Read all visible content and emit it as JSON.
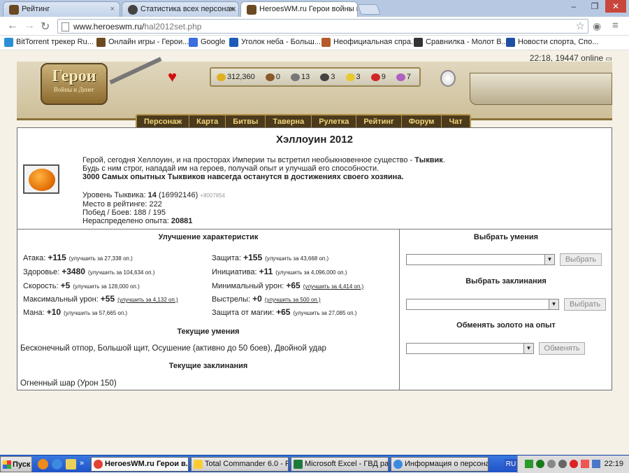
{
  "browser": {
    "tabs": [
      {
        "title": "Рейтинг",
        "active": false
      },
      {
        "title": "Статистика всех персонаж",
        "active": false
      },
      {
        "title": "HeroesWM.ru Герои войны и",
        "active": true
      }
    ],
    "close_glyph": "×",
    "url_host": "www.heroeswm.ru/",
    "url_path": "hal2012set.php",
    "bookmarks": [
      "BitTorrent трекер Ru...",
      "Онлайн игры - Герои...",
      "Google",
      "Уголок неба - Больш...",
      "Неофициальная спра...",
      "Сравнилка - Молот В...",
      "Новости спорта, Спо..."
    ]
  },
  "game": {
    "online_text": "22:18, 19447 online",
    "logo_main": "Герои",
    "logo_sub": "Войны и Денег",
    "resources": [
      "312,360",
      "0",
      "13",
      "3",
      "3",
      "9",
      "7"
    ],
    "menu": [
      "Персонаж",
      "Карта",
      "Битвы",
      "Таверна",
      "Рулетка",
      "Рейтинг",
      "Форум",
      "Чат"
    ]
  },
  "page": {
    "title": "Хэллоуин 2012",
    "intro_line1_a": "Герой, сегодня Хеллоуин, и на просторах Империи ты встретил необыкновенное существо - ",
    "intro_line1_b": "Тыквик",
    "intro_line1_c": ".",
    "intro_line2": "Будь с ним строг, нападай им на героев, получай опыт и улучшай его способности.",
    "intro_line3": "3000 Самых опытных Тыквиков навсегда останутся в достижениях своего хозяина.",
    "level_label": "Уровень Тыквика: ",
    "level_value": "14",
    "level_exp": " (16992146)",
    "level_delta": "+8007854",
    "rank": "Место в рейтинге: 222",
    "wins": "Побед / Боев: 188 / 195",
    "free_exp_label": "Нераспределено опыта: ",
    "free_exp_value": "20881"
  },
  "upgrades": {
    "title": "Улучшение характеристик",
    "left": [
      {
        "label": "Атака: ",
        "value": "+115",
        "improve": "(улучшить за 27,338 оп.)",
        "link": false
      },
      {
        "label": "Здоровье: ",
        "value": "+3480",
        "improve": "(улучшить за 104,634 оп.)",
        "link": false
      },
      {
        "label": "Скорость: ",
        "value": "+5",
        "improve": "(улучшить за 128,000 оп.)",
        "link": false
      },
      {
        "label": "Максимальный урон: ",
        "value": "+55",
        "improve": "(улучшить за 4,132 оп.)",
        "link": true
      },
      {
        "label": "Мана: ",
        "value": "+10",
        "improve": "(улучшить за 57,665 оп.)",
        "link": false
      }
    ],
    "right": [
      {
        "label": "Защита: ",
        "value": "+155",
        "improve": "(улучшить за 43,668 оп.)",
        "link": false
      },
      {
        "label": "Инициатива: ",
        "value": "+11",
        "improve": "(улучшить за 4,096,000 оп.)",
        "link": false
      },
      {
        "label": "Минимальный урон: ",
        "value": "+65",
        "improve": "(улучшить за 4,414 оп.)",
        "link": true
      },
      {
        "label": "Выстрелы: ",
        "value": "+0",
        "improve": "(улучшить за 500 оп.)",
        "link": true
      },
      {
        "label": "Защита от магии: ",
        "value": "+65",
        "improve": "(улучшить за 27,085 оп.)",
        "link": false
      }
    ],
    "skills_title": "Текущие умения",
    "skills": "Бесконечный отпор, Большой щит, Осушение (активно до 50 боев), Двойной удар",
    "spells_title": "Текущие заклинания",
    "spells": "Огненный шар (Урон 150)"
  },
  "side": {
    "skills_title": "Выбрать умения",
    "skills_btn": "Выбрать",
    "spells_title": "Выбрать заклинания",
    "spells_btn": "Выбрать",
    "gold_title": "Обменять золото на опыт",
    "gold_btn": "Обменять"
  },
  "taskbar": {
    "start": "Пуск",
    "tasks": [
      {
        "title": "HeroesWM.ru Герои в...",
        "active": true
      },
      {
        "title": "Total Commander 6.0 - P...",
        "active": false
      },
      {
        "title": "Microsoft Excel - ГВД ра...",
        "active": false
      },
      {
        "title": "Информация о персона...",
        "active": false
      }
    ],
    "lang": "RU",
    "clock": "22:19"
  },
  "colors": {
    "accent": "#b49149",
    "menu_bg": "#4b3a1b",
    "menu_text": "#f0d47c"
  }
}
